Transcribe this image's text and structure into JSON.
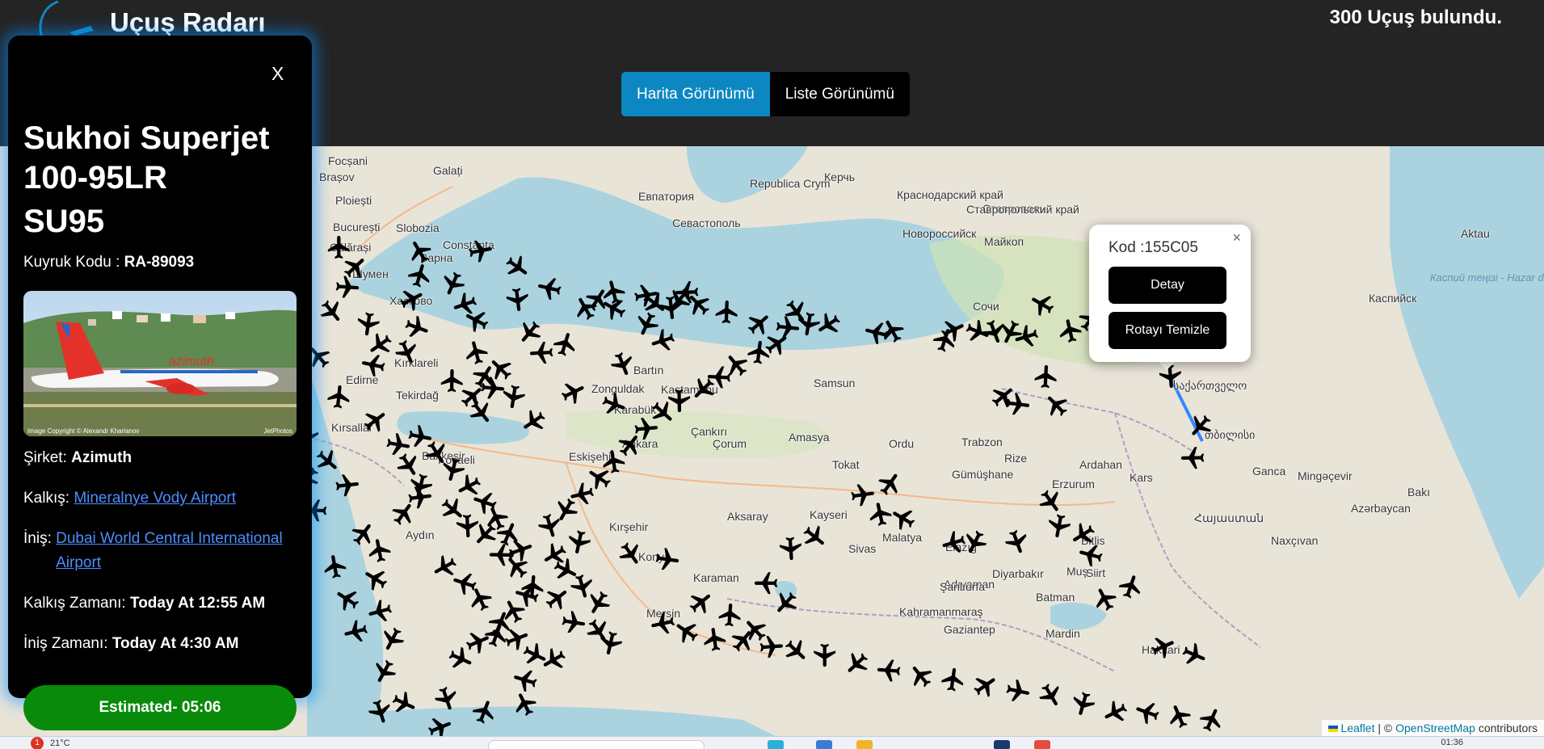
{
  "header": {
    "app_title": "Uçuş Radarı",
    "flight_count": "300 Uçuş bulundu.",
    "view_map_label": "Harita Görünümü",
    "view_list_label": "Liste Görünümü",
    "accent_color": "#0d87c2"
  },
  "panel": {
    "close_label": "X",
    "model": "Sukhoi Superjet 100-95LR",
    "icao": "SU95",
    "tail_label": "Kuyruk Kodu : ",
    "tail_value": "RA-89093",
    "photo_credit": "Image Copyright © Alexandr Kharlanov",
    "photo_source": "JetPhotos",
    "photo_livery_text": "azimuth",
    "airline_label": "Şirket: ",
    "airline_value": "Azimuth",
    "departure_label": "Kalkış: ",
    "departure_value": "Mineralnye Vody Airport",
    "arrival_label": "İniş: ",
    "arrival_value": "Dubai World Central International Airport",
    "departure_time_label": "Kalkış Zamanı: ",
    "departure_time_value": "Today At 12:55 AM",
    "arrival_time_label": "İniş Zamanı: ",
    "arrival_time_value": "Today At 4:30 AM",
    "estimated": "Estimated- 05:06",
    "estimated_color": "#0a8a0a"
  },
  "popup": {
    "code": "Kod :155C05",
    "close_label": "×",
    "detail_button": "Detay",
    "clear_route_button": "Rotayı Temizle"
  },
  "map": {
    "attribution_leaflet": "Leaflet",
    "attribution_sep": " | © ",
    "attribution_osm": "OpenStreetMap",
    "attribution_tail": " contributors",
    "route_color": "#3388ff",
    "places": [
      {
        "name": "Focșani"
      },
      {
        "name": "Galați"
      },
      {
        "name": "Brașov"
      },
      {
        "name": "Ploiești"
      },
      {
        "name": "București"
      },
      {
        "name": "Slobozia"
      },
      {
        "name": "Călărași"
      },
      {
        "name": "Constanța"
      },
      {
        "name": "Republica Crym"
      },
      {
        "name": "Евпатория"
      },
      {
        "name": "Севастополь"
      },
      {
        "name": "Керчь"
      },
      {
        "name": "Краснодарский край"
      },
      {
        "name": "Новороссийск"
      },
      {
        "name": "Ставрополь"
      },
      {
        "name": "Ставропольский край"
      },
      {
        "name": "Майкоп"
      },
      {
        "name": "Сочи"
      },
      {
        "name": "Aktau"
      },
      {
        "name": "Каспийск"
      },
      {
        "name": "Каспий теңізі - Hazar dənizi - Caspian Sea"
      },
      {
        "name": "Шумен"
      },
      {
        "name": "Варна"
      },
      {
        "name": "Edirne"
      },
      {
        "name": "Kırklareli"
      },
      {
        "name": "Tekirdağ"
      },
      {
        "name": "Balıkesir"
      },
      {
        "name": "Aydın"
      },
      {
        "name": "Eskişehir"
      },
      {
        "name": "Ankara"
      },
      {
        "name": "Kırşehir"
      },
      {
        "name": "Aksaray"
      },
      {
        "name": "Konya"
      },
      {
        "name": "Karaman"
      },
      {
        "name": "Mersin"
      },
      {
        "name": "Zonguldak"
      },
      {
        "name": "Karabük"
      },
      {
        "name": "Kastamonu"
      },
      {
        "name": "Çankırı"
      },
      {
        "name": "Çorum"
      },
      {
        "name": "Bartın"
      },
      {
        "name": "Samsun"
      },
      {
        "name": "Amasya"
      },
      {
        "name": "Tokat"
      },
      {
        "name": "Ordu"
      },
      {
        "name": "Sivas"
      },
      {
        "name": "Kayseri"
      },
      {
        "name": "Malatya"
      },
      {
        "name": "Elazığ"
      },
      {
        "name": "Trabzon"
      },
      {
        "name": "Gümüşhane"
      },
      {
        "name": "Erzurum"
      },
      {
        "name": "Rize"
      },
      {
        "name": "Ardahan"
      },
      {
        "name": "Kars"
      },
      {
        "name": "Muş"
      },
      {
        "name": "Bitlis"
      },
      {
        "name": "Siirt"
      },
      {
        "name": "Batman"
      },
      {
        "name": "Mardin"
      },
      {
        "name": "Adıyaman"
      },
      {
        "name": "Kahramanmaraş"
      },
      {
        "name": "Gaziantep"
      },
      {
        "name": "Şanlıurfa"
      },
      {
        "name": "Diyarbakır"
      },
      {
        "name": "Hakkari"
      },
      {
        "name": "Ganca"
      },
      {
        "name": "Mingəçevir"
      },
      {
        "name": "Azərbaycan"
      },
      {
        "name": "Bakı"
      },
      {
        "name": "Naxçıvan"
      },
      {
        "name": "Հայաստան"
      },
      {
        "name": "საქართველო"
      },
      {
        "name": "თბილისი"
      },
      {
        "name": "Хасково"
      },
      {
        "name": "Kırsallar"
      },
      {
        "name": "Kocaeli"
      }
    ]
  },
  "taskbar": {
    "weather": "21°C",
    "notification_count": "1",
    "clock": "01:36"
  }
}
